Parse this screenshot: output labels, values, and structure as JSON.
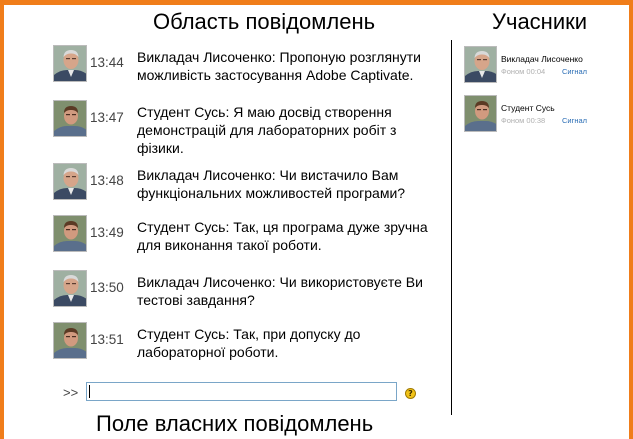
{
  "captions": {
    "messages_area": "Область повідомлень",
    "participants": "Учасники",
    "own_message_field": "Поле власних повідомлень"
  },
  "messages": [
    {
      "time": "13:44",
      "text": "Викладач Лисоченко: Пропоную розглянути можливість застосування Adobe  Captivate.",
      "avatar": "lecturer"
    },
    {
      "time": "13:47",
      "text": "Студент Сусь: Я маю досвід створення демонстрацій для лабораторних робіт з фізики.",
      "avatar": "student"
    },
    {
      "time": "13:48",
      "text": "Викладач Лисоченко: Чи вистачило Вам функціональних можливостей програми?",
      "avatar": "lecturer"
    },
    {
      "time": "13:49",
      "text": "Студент Сусь: Так, ця програма дуже зручна для виконання такої роботи.",
      "avatar": "student"
    },
    {
      "time": "13:50",
      "text": "Викладач Лисоченко: Чи використовуєте Ви тестові завдання?",
      "avatar": "lecturer"
    },
    {
      "time": "13:51",
      "text": "Студент Сусь: Так, при допуску до лабораторної роботи.",
      "avatar": "student"
    }
  ],
  "input": {
    "prompt": ">>",
    "value": ""
  },
  "help_icon": "question-icon",
  "participants": [
    {
      "name": "Викладач Лисоченко",
      "status": "Фоном 00:04",
      "signal": "Сигнал",
      "avatar": "lecturer"
    },
    {
      "name": "Студент Сусь",
      "status": "Фоном 00:38",
      "signal": "Сигнал",
      "avatar": "student"
    }
  ],
  "colors": {
    "frame": "#f07d1a",
    "signal_link": "#2a6db5",
    "input_border": "#7aa6c8"
  }
}
